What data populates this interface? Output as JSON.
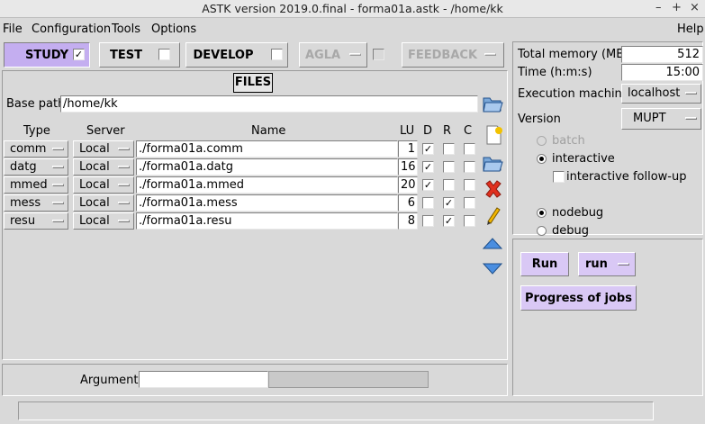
{
  "window": {
    "title": "ASTK version 2019.0.final - forma01a.astk - /home/kk",
    "controls": {
      "minimize": "–",
      "maximize": "+",
      "close": "×"
    }
  },
  "menu": {
    "items": [
      {
        "label": "File"
      },
      {
        "label": "Configuration"
      },
      {
        "label": "Tools"
      },
      {
        "label": "Options"
      },
      {
        "label": "Help"
      }
    ]
  },
  "modes": {
    "study": "STUDY",
    "test": "TEST",
    "develop": "DEVELOP",
    "agla": "AGLA",
    "feedback": "FEEDBACK",
    "study_checked": "✓"
  },
  "files": {
    "title": "FILES",
    "base_path_label": "Base path",
    "base_path": "/home/kk",
    "headers": {
      "type": "Type",
      "server": "Server",
      "name": "Name",
      "lu": "LU",
      "d": "D",
      "r": "R",
      "c": "C"
    },
    "rows": [
      {
        "type": "comm",
        "server": "Local",
        "name": "./forma01a.comm",
        "lu": "1",
        "d": "✓",
        "r": "",
        "c": ""
      },
      {
        "type": "datg",
        "server": "Local",
        "name": "./forma01a.datg",
        "lu": "16",
        "d": "✓",
        "r": "",
        "c": ""
      },
      {
        "type": "mmed",
        "server": "Local",
        "name": "./forma01a.mmed",
        "lu": "20",
        "d": "✓",
        "r": "",
        "c": ""
      },
      {
        "type": "mess",
        "server": "Local",
        "name": "./forma01a.mess",
        "lu": "6",
        "d": "",
        "r": "✓",
        "c": ""
      },
      {
        "type": "resu",
        "server": "Local",
        "name": "./forma01a.resu",
        "lu": "8",
        "d": "",
        "r": "✓",
        "c": ""
      }
    ],
    "arguments_label": "Arguments",
    "arguments_value": ""
  },
  "settings": {
    "total_memory_label": "Total memory (MB)",
    "total_memory": "512",
    "time_label": "Time (h:m:s)",
    "time": "15:00",
    "exec_machine_label": "Execution machine",
    "exec_machine": "localhost",
    "version_label": "Version",
    "version": "MUPT",
    "batch": "batch",
    "interactive": "interactive",
    "interactive_followup": "interactive follow-up",
    "nodebug": "nodebug",
    "debug": "debug"
  },
  "run": {
    "run_label": "Run",
    "run_mode": "run",
    "progress_label": "Progress of jobs"
  },
  "status": {
    "text": ""
  },
  "colors": {
    "accent": "#d9c8f5",
    "selected": "#c4aef0",
    "background": "#d9d9d9"
  }
}
